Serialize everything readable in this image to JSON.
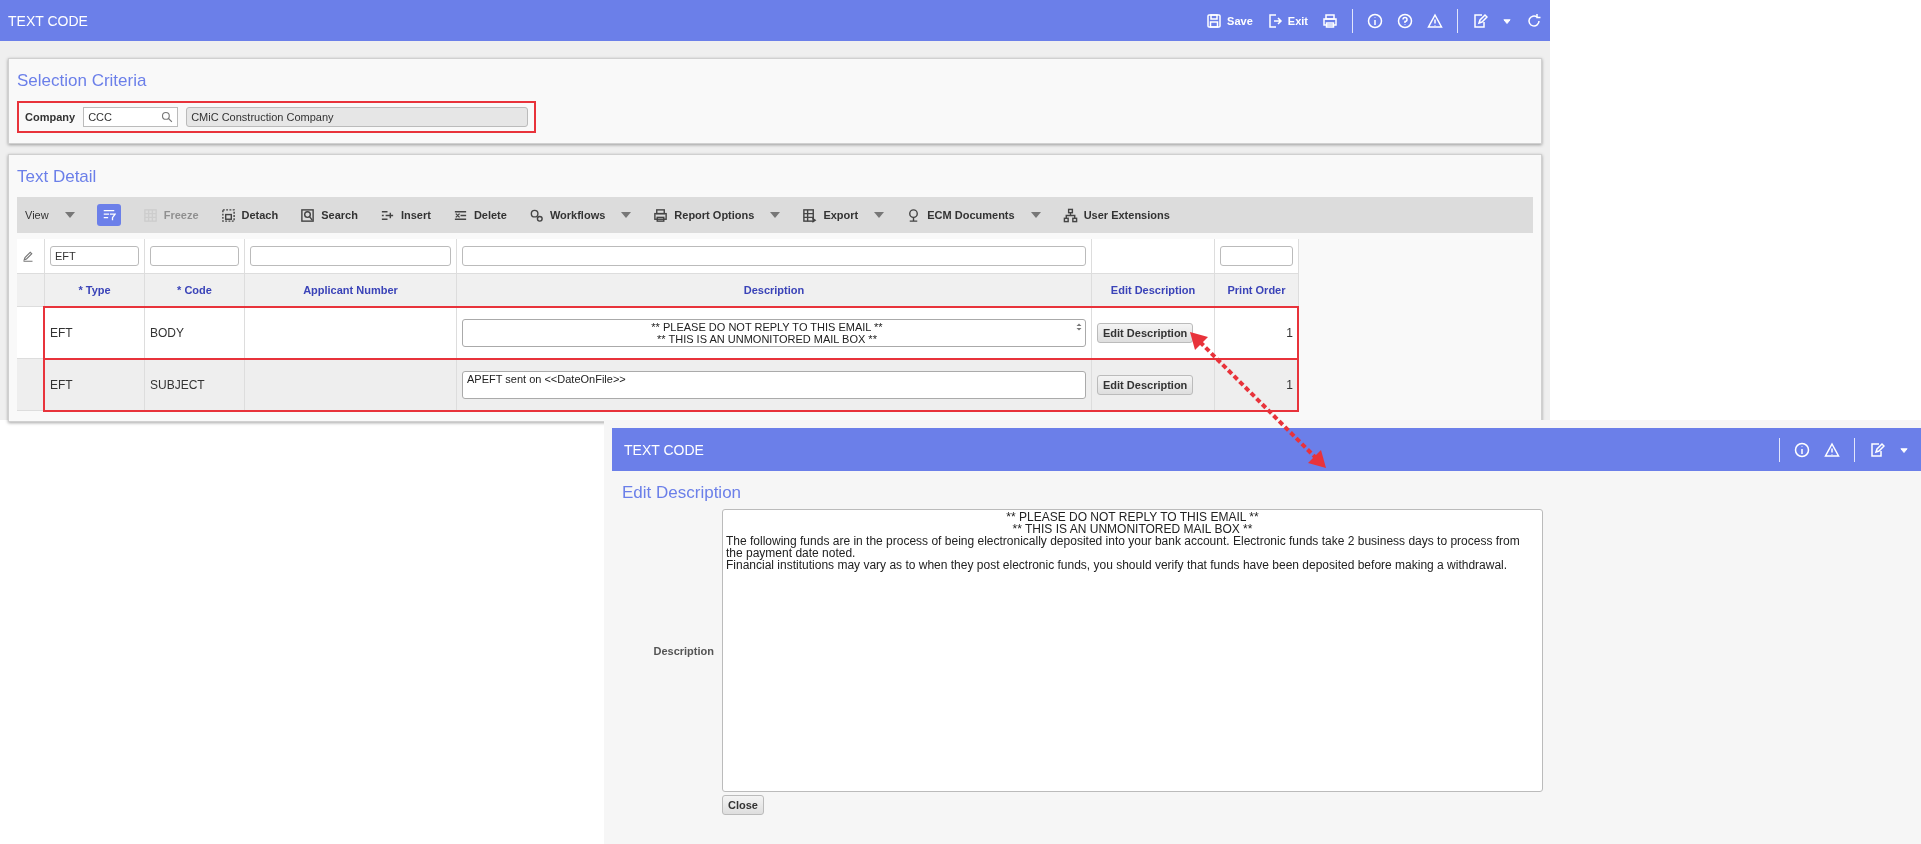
{
  "app_bar": {
    "title": "TEXT CODE",
    "actions": [
      {
        "label": "Save",
        "kind": "save"
      },
      {
        "label": "Exit",
        "kind": "exit"
      }
    ]
  },
  "selection_criteria": {
    "title": "Selection Criteria",
    "company_label": "Company",
    "company_code": "CCC",
    "company_name": "CMiC Construction Company",
    "highlighted": true
  },
  "text_detail": {
    "title": "Text Detail",
    "toolbar": [
      {
        "label": "View",
        "kind": "view",
        "dropdown": true,
        "disabled": false
      },
      {
        "kind": "filter",
        "dropdown": false,
        "disabled": false
      },
      {
        "label": "Freeze",
        "kind": "freeze",
        "dropdown": false,
        "disabled": true
      },
      {
        "label": "Detach",
        "kind": "detach",
        "dropdown": false,
        "disabled": false
      },
      {
        "label": "Search",
        "kind": "search",
        "dropdown": false,
        "disabled": false
      },
      {
        "label": "Insert",
        "kind": "insert",
        "dropdown": false,
        "disabled": false
      },
      {
        "label": "Delete",
        "kind": "delete",
        "dropdown": false,
        "disabled": false
      },
      {
        "label": "Workflows",
        "kind": "workflows",
        "dropdown": true,
        "disabled": false
      },
      {
        "label": "Report Options",
        "kind": "print",
        "dropdown": true,
        "disabled": false
      },
      {
        "label": "Export",
        "kind": "export",
        "dropdown": true,
        "disabled": false
      },
      {
        "label": "ECM Documents",
        "kind": "ecm",
        "dropdown": true,
        "disabled": false
      },
      {
        "label": "User Extensions",
        "kind": "extensions",
        "dropdown": false,
        "disabled": false
      }
    ],
    "columns": [
      {
        "label": "* Type",
        "filter": true,
        "filter_value": "EFT"
      },
      {
        "label": "* Code",
        "filter": true
      },
      {
        "label": "Applicant Number",
        "filter": true
      },
      {
        "label": "Description",
        "filter": true
      },
      {
        "label": "Edit Description",
        "filter": false
      },
      {
        "label": "Print Order",
        "filter": true
      }
    ],
    "rows": [
      {
        "type": "EFT",
        "code": "BODY",
        "description": [
          {
            "text": "** PLEASE DO NOT REPLY TO THIS EMAIL **",
            "kind": "centered"
          },
          {
            "text": "** THIS IS AN UNMONITORED MAIL BOX **",
            "kind": "centered"
          }
        ],
        "scrollable": true,
        "button": "Edit Description",
        "print_order": "1",
        "highlighted": true
      },
      {
        "type": "EFT",
        "code": "SUBJECT",
        "description": [
          {
            "text": "APEFT sent on <<DateOnFile>>",
            "kind": "plain"
          }
        ],
        "scrollable": false,
        "button": "Edit Description",
        "print_order": "1",
        "highlighted": true
      }
    ]
  },
  "dialog": {
    "title": "TEXT CODE",
    "heading": "Edit Description",
    "field_label": "Description",
    "lines": [
      {
        "text": "** PLEASE DO NOT REPLY TO THIS EMAIL **",
        "kind": "centered"
      },
      {
        "text": "** THIS IS AN UNMONITORED MAIL BOX **",
        "kind": "centered"
      },
      {
        "text": "The following funds are in the process of being electronically deposited into your bank account. Electronic funds take 2 business days to process from the payment date noted.",
        "kind": "plain"
      },
      {
        "text": "Financial institutions may vary as to when they post electronic funds, you should verify that funds have been deposited before making a withdrawal.",
        "kind": "plain"
      }
    ],
    "button": "Close"
  }
}
